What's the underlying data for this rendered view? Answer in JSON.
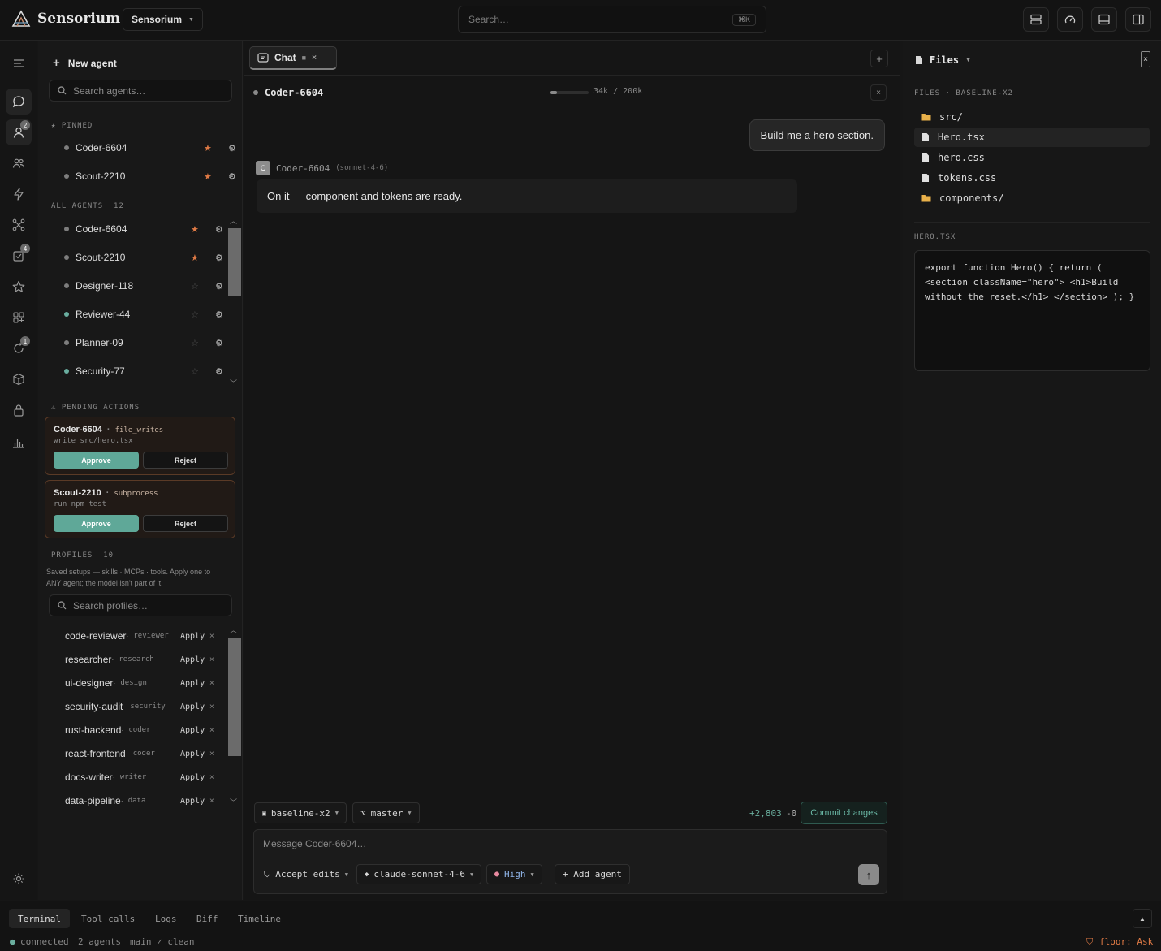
{
  "app": {
    "name": "Sensorium",
    "workspace": "Sensorium",
    "search_placeholder": "Search…",
    "search_shortcut": "⌘K"
  },
  "rail": {
    "badges": {
      "agents": "2",
      "tasks": "4",
      "alerts": "1"
    }
  },
  "sidebar": {
    "new_agent": "New agent",
    "search_placeholder": "Search agents…",
    "pinned_label": "PINNED",
    "pinned": [
      {
        "name": "Coder-6604",
        "starred": true
      },
      {
        "name": "Scout-2210",
        "starred": true
      }
    ],
    "all_label": "ALL AGENTS",
    "all_count": "12",
    "agents": [
      {
        "name": "Coder-6604",
        "starred": true,
        "online": false
      },
      {
        "name": "Scout-2210",
        "starred": true,
        "online": false
      },
      {
        "name": "Designer-118",
        "starred": false,
        "online": false
      },
      {
        "name": "Reviewer-44",
        "starred": false,
        "online": true
      },
      {
        "name": "Planner-09",
        "starred": false,
        "online": false
      },
      {
        "name": "Security-77",
        "starred": false,
        "online": true
      }
    ],
    "pending_label": "PENDING ACTIONS",
    "pending": [
      {
        "agent": "Coder-6604",
        "type": "file_writes",
        "cmd": "write src/hero.tsx",
        "approve": "Approve",
        "reject": "Reject"
      },
      {
        "agent": "Scout-2210",
        "type": "subprocess",
        "cmd": "run npm test",
        "approve": "Approve",
        "reject": "Reject"
      }
    ],
    "profiles_label": "PROFILES",
    "profiles_count": "10",
    "profiles_desc_1": "Saved setups — skills · MCPs · tools. Apply one to",
    "profiles_desc_2": "ANY agent; the model isn't part of it.",
    "profiles_search_placeholder": "Search profiles…",
    "profiles": [
      {
        "name": "code-reviewer",
        "tag": "reviewer",
        "apply": "Apply"
      },
      {
        "name": "researcher",
        "tag": "research",
        "apply": "Apply"
      },
      {
        "name": "ui-designer",
        "tag": "design",
        "apply": "Apply"
      },
      {
        "name": "security-audit",
        "tag": "security",
        "apply": "Apply"
      },
      {
        "name": "rust-backend",
        "tag": "coder",
        "apply": "Apply"
      },
      {
        "name": "react-frontend",
        "tag": "coder",
        "apply": "Apply"
      },
      {
        "name": "docs-writer",
        "tag": "writer",
        "apply": "Apply"
      },
      {
        "name": "data-pipeline",
        "tag": "data",
        "apply": "Apply"
      }
    ]
  },
  "chat": {
    "tab_label": "Chat",
    "agent_name": "Coder-6604",
    "context_used": "34k",
    "context_sep": "/",
    "context_max": "200k",
    "context_fraction": 0.17,
    "messages": {
      "user": "Build me a hero section.",
      "assistant_avatar": "C",
      "assistant_name": "Coder-6604",
      "assistant_model": "(sonnet-4-6)",
      "assistant_text": "On it — component and tokens are ready."
    },
    "branch_bar": {
      "workspace": "baseline-x2",
      "branch": "master",
      "added": "+2,803",
      "removed": "-0",
      "commit": "Commit changes"
    },
    "composer": {
      "placeholder": "Message Coder-6604…",
      "accept": "Accept edits",
      "model": "claude-sonnet-4-6",
      "effort": "High",
      "add_agent": "+ Add agent",
      "send": "↑"
    }
  },
  "files": {
    "title": "Files",
    "section_label": "FILES",
    "section_sep": "·",
    "workspace": "BASELINE-X2",
    "tree": [
      {
        "name": "src/",
        "kind": "folder"
      },
      {
        "name": "Hero.tsx",
        "kind": "file",
        "selected": true
      },
      {
        "name": "hero.css",
        "kind": "file"
      },
      {
        "name": "tokens.css",
        "kind": "file"
      },
      {
        "name": "components/",
        "kind": "folder"
      }
    ],
    "preview_label": "HERO.TSX",
    "code": "export function Hero() { return ( <section className=\"hero\"> <h1>Build without the reset.</h1> </section> ); }"
  },
  "bottom": {
    "tabs": [
      "Terminal",
      "Tool calls",
      "Logs",
      "Diff",
      "Timeline"
    ],
    "status": {
      "connection": "connected",
      "agents": "2 agents",
      "git": "main ✓ clean",
      "floor": "floor: Ask"
    }
  },
  "colors": {
    "accent": "#5fa898",
    "star": "#e07a45",
    "warning": "#5a3a26"
  }
}
